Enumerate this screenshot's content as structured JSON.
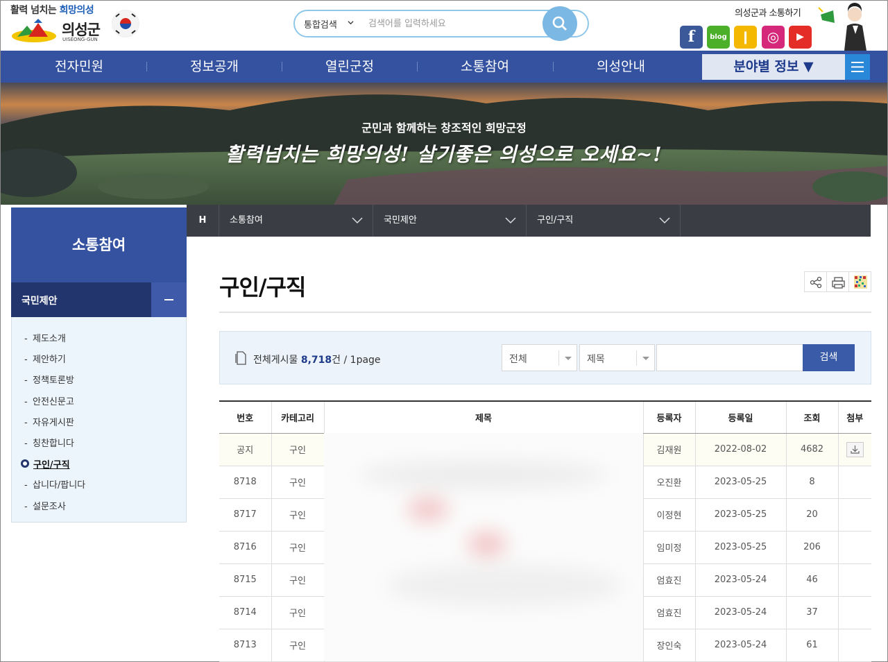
{
  "header": {
    "slogan_prefix": "활력 넘치는 ",
    "slogan_highlight": "희망의성",
    "logo_name": "의성군",
    "logo_en": "UISEONG-GUN",
    "search_category": "통합검색",
    "search_placeholder": "검색어를 입력하세요",
    "communicate_label": "의성군과 소통하기",
    "social": [
      {
        "name": "facebook",
        "glyph": "f",
        "color": "#3b5998"
      },
      {
        "name": "blog",
        "glyph": "blog",
        "color": "#4caf2a"
      },
      {
        "name": "kakaostory",
        "glyph": "❙",
        "color": "#f5b800"
      },
      {
        "name": "instagram",
        "glyph": "◎",
        "color": "#d6287a"
      },
      {
        "name": "youtube",
        "glyph": "▶",
        "color": "#e52d27"
      }
    ]
  },
  "gnb": {
    "items": [
      "전자민원",
      "정보공개",
      "열린군정",
      "소통참여",
      "의성안내"
    ],
    "field_info": "분야별 정보"
  },
  "banner": {
    "subtitle": "군민과 함께하는 창조적인 희망군정",
    "title": "활력넘치는 희망의성! 살기좋은 의성으로 오세요~!"
  },
  "lnb": {
    "title": "소통참여",
    "section": "국민제안",
    "items": [
      "제도소개",
      "제안하기",
      "정책토론방",
      "안전신문고",
      "자유게시판",
      "칭찬합니다",
      "구인/구직",
      "삽니다/팝니다",
      "설문조사"
    ],
    "active": "구인/구직"
  },
  "location": {
    "home": "H",
    "items": [
      "소통참여",
      "국민제안",
      "구인/구직"
    ]
  },
  "content": {
    "title": "구인/구직",
    "total_label": "전체게시물",
    "total_count": "8,718",
    "total_unit": "건",
    "page_info": "/ 1page",
    "select_scope": "전체",
    "select_field": "제목",
    "search_button": "검색"
  },
  "table": {
    "headers": [
      "번호",
      "카테고리",
      "제목",
      "등록자",
      "등록일",
      "조회",
      "첨부"
    ],
    "rows": [
      {
        "no": "공지",
        "cat": "구인",
        "title": "",
        "author": "김재원",
        "date": "2022-08-02",
        "views": "4682",
        "attach": true
      },
      {
        "no": "8718",
        "cat": "구인",
        "title": "",
        "author": "오진환",
        "date": "2023-05-25",
        "views": "8",
        "attach": false
      },
      {
        "no": "8717",
        "cat": "구인",
        "title": "",
        "author": "이정현",
        "date": "2023-05-25",
        "views": "20",
        "attach": false
      },
      {
        "no": "8716",
        "cat": "구인",
        "title": "",
        "author": "임미정",
        "date": "2023-05-25",
        "views": "206",
        "attach": false
      },
      {
        "no": "8715",
        "cat": "구인",
        "title": "",
        "author": "엄효진",
        "date": "2023-05-24",
        "views": "46",
        "attach": false
      },
      {
        "no": "8714",
        "cat": "구인",
        "title": "",
        "author": "엄효진",
        "date": "2023-05-24",
        "views": "37",
        "attach": false
      },
      {
        "no": "8713",
        "cat": "구인",
        "title": "",
        "author": "장인숙",
        "date": "2023-05-24",
        "views": "61",
        "attach": false
      }
    ]
  }
}
